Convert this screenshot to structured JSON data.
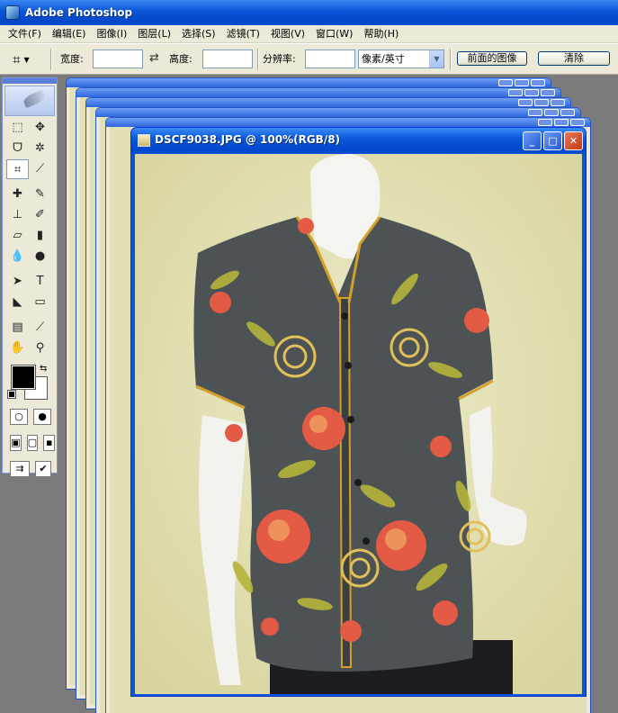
{
  "app": {
    "title": "Adobe Photoshop"
  },
  "menu": [
    "文件(F)",
    "编辑(E)",
    "图像(I)",
    "图层(L)",
    "选择(S)",
    "滤镜(T)",
    "视图(V)",
    "窗口(W)",
    "帮助(H)"
  ],
  "options": {
    "width_label": "宽度:",
    "height_label": "高度:",
    "resolution_label": "分辨率:",
    "unit_select": "像素/英寸",
    "front_image_button": "前面的图像",
    "clear_button": "清除",
    "width_value": "",
    "height_value": "",
    "resolution_value": ""
  },
  "document": {
    "title": "DSCF9038.JPG @ 100%(RGB/8)"
  },
  "colors": {
    "foreground": "#000000",
    "background": "#ffffff",
    "accent": "#0a55d8"
  },
  "icons": [
    "crop-icon",
    "swap-icon",
    "marquee-icon",
    "move-icon",
    "lasso-icon",
    "magic-wand-icon",
    "heal-icon",
    "brush-icon",
    "stamp-icon",
    "history-brush-icon",
    "eraser-icon",
    "gradient-icon",
    "blur-icon",
    "dodge-icon",
    "path-select-icon",
    "type-icon",
    "pen-icon",
    "shape-icon",
    "notes-icon",
    "eyedropper-icon",
    "hand-icon",
    "zoom-icon"
  ]
}
